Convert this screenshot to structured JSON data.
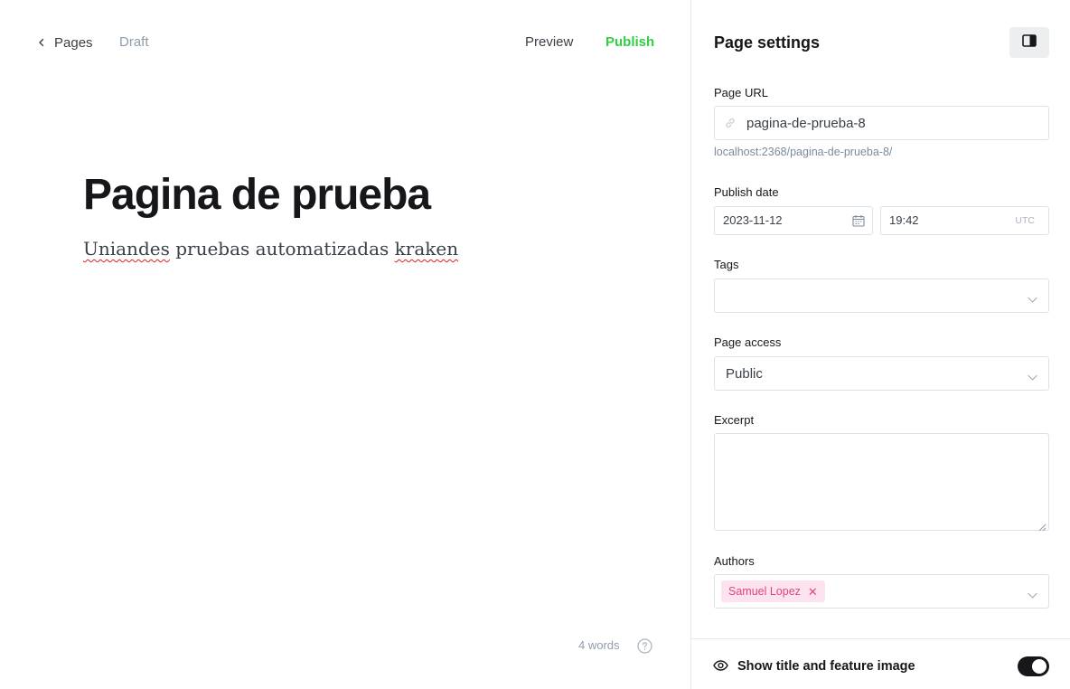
{
  "topbar": {
    "back_label": "Pages",
    "status": "Draft",
    "preview_label": "Preview",
    "publish_label": "Publish"
  },
  "editor": {
    "title": "Pagina de prueba",
    "body_words": [
      "Uniandes",
      " pruebas automatizadas ",
      "kraken"
    ],
    "word_count": "4 words"
  },
  "settings": {
    "title": "Page settings",
    "page_url": {
      "label": "Page URL",
      "value": "pagina-de-prueba-8",
      "hint": "localhost:2368/pagina-de-prueba-8/"
    },
    "publish_date": {
      "label": "Publish date",
      "date": "2023-11-12",
      "time": "19:42",
      "timezone": "UTC"
    },
    "tags": {
      "label": "Tags",
      "value": ""
    },
    "page_access": {
      "label": "Page access",
      "value": "Public"
    },
    "excerpt": {
      "label": "Excerpt",
      "value": ""
    },
    "authors": {
      "label": "Authors",
      "items": [
        "Samuel Lopez"
      ]
    },
    "show_title": {
      "label": "Show title and feature image",
      "enabled": true
    }
  },
  "colors": {
    "publish": "#30cf43",
    "author_chip_bg": "#fde3ef",
    "author_chip_text": "#e1467c",
    "toggle_on": "#15171a"
  }
}
